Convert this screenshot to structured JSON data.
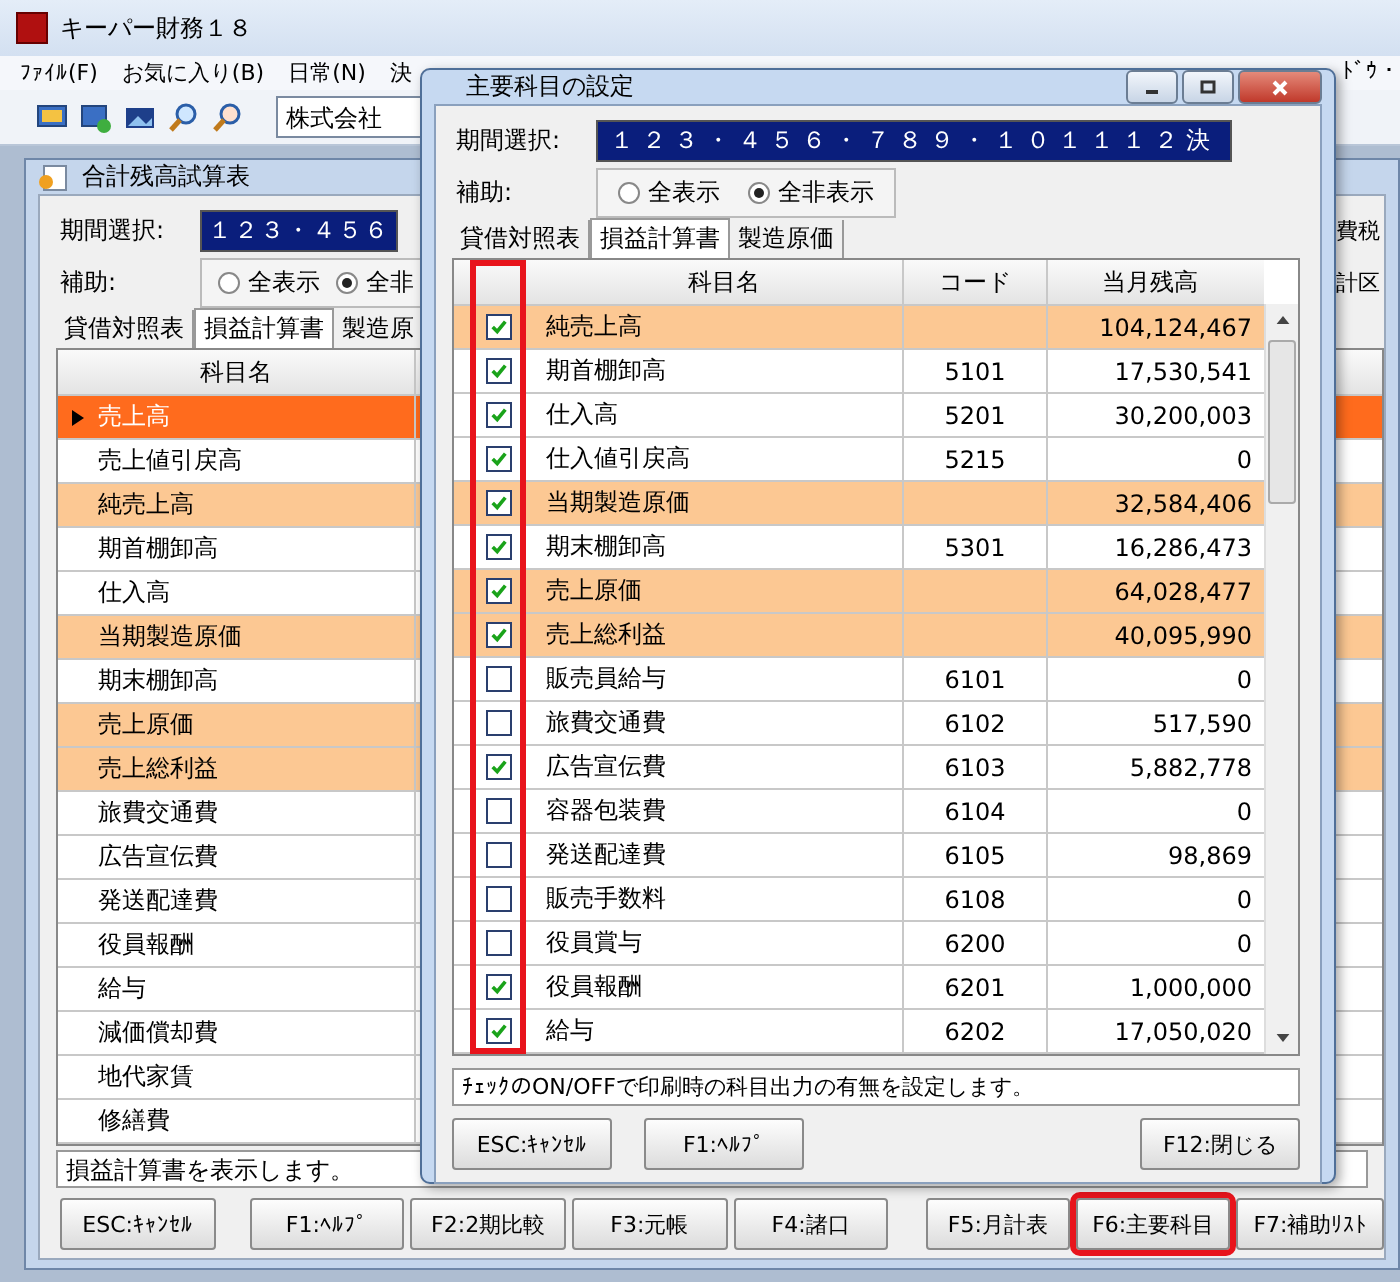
{
  "app": {
    "title": "キーパー財務１８",
    "menu": [
      "ﾌｧｲﾙ(F)",
      "お気に入り(B)",
      "日常(N)",
      "決"
    ],
    "menu_right": "ﾄﾞｳ・",
    "toolbar_combo": "株式会社"
  },
  "report_window": {
    "title": "合計残高試算表",
    "period_label": "期間選択:",
    "period_value": "１２３・４５６",
    "aux_label": "補助:",
    "aux_options": [
      {
        "label": "全表示",
        "selected": false
      },
      {
        "label": "全非",
        "selected": true
      }
    ],
    "tabs": [
      {
        "label": "貸借対照表",
        "selected": false
      },
      {
        "label": "損益計算書",
        "selected": true
      },
      {
        "label": "製造原",
        "selected": false
      }
    ],
    "side_labels": [
      "費税",
      "計区"
    ],
    "grid": {
      "column": "科目名",
      "rows": [
        {
          "name": "売上高",
          "highlighted": true,
          "selected": true
        },
        {
          "name": "売上値引戻高",
          "highlighted": false,
          "selected": false
        },
        {
          "name": "純売上高",
          "highlighted": true,
          "selected": false
        },
        {
          "name": "期首棚卸高",
          "highlighted": false,
          "selected": false
        },
        {
          "name": "仕入高",
          "highlighted": false,
          "selected": false
        },
        {
          "name": "当期製造原価",
          "highlighted": true,
          "selected": false
        },
        {
          "name": "期末棚卸高",
          "highlighted": false,
          "selected": false
        },
        {
          "name": "売上原価",
          "highlighted": true,
          "selected": false
        },
        {
          "name": "売上総利益",
          "highlighted": true,
          "selected": false
        },
        {
          "name": "旅費交通費",
          "highlighted": false,
          "selected": false
        },
        {
          "name": "広告宣伝費",
          "highlighted": false,
          "selected": false
        },
        {
          "name": "発送配達費",
          "highlighted": false,
          "selected": false
        },
        {
          "name": "役員報酬",
          "highlighted": false,
          "selected": false
        },
        {
          "name": "給与",
          "highlighted": false,
          "selected": false
        },
        {
          "name": "減価償却費",
          "highlighted": false,
          "selected": false
        },
        {
          "name": "地代家賃",
          "highlighted": false,
          "selected": false
        },
        {
          "name": "修繕費",
          "highlighted": false,
          "selected": false
        }
      ]
    },
    "status": "損益計算書を表示します。",
    "buttons": [
      {
        "label": "ESC:ｷｬﾝｾﾙ",
        "marked": false
      },
      {
        "label": "F1:ﾍﾙﾌﾟ",
        "marked": false
      },
      {
        "label": "F2:2期比較",
        "marked": false
      },
      {
        "label": "F3:元帳",
        "marked": false
      },
      {
        "label": "F4:諸口",
        "marked": false
      },
      {
        "label": "F5:月計表",
        "marked": false
      },
      {
        "label": "F6:主要科目",
        "marked": true
      },
      {
        "label": "F7:補助ﾘｽﾄ",
        "marked": false
      }
    ]
  },
  "dialog": {
    "title": "主要科目の設定",
    "period_label": "期間選択:",
    "period_value": "１２３・４５６・７８９・１０１１１２決",
    "aux_label": "補助:",
    "aux_options": [
      {
        "label": "全表示",
        "selected": false
      },
      {
        "label": "全非表示",
        "selected": true
      }
    ],
    "tabs": [
      {
        "label": "貸借対照表",
        "selected": false
      },
      {
        "label": "損益計算書",
        "selected": true
      },
      {
        "label": "製造原価",
        "selected": false
      }
    ],
    "columns": [
      "科目名",
      "コード",
      "当月残高"
    ],
    "check_column_marked": true,
    "rows": [
      {
        "checked": true,
        "name": "純売上高",
        "code": "",
        "balance": "104,124,467",
        "highlighted": true
      },
      {
        "checked": true,
        "name": "期首棚卸高",
        "code": "5101",
        "balance": "17,530,541",
        "highlighted": false
      },
      {
        "checked": true,
        "name": "仕入高",
        "code": "5201",
        "balance": "30,200,003",
        "highlighted": false
      },
      {
        "checked": true,
        "name": "仕入値引戻高",
        "code": "5215",
        "balance": "0",
        "highlighted": false
      },
      {
        "checked": true,
        "name": "当期製造原価",
        "code": "",
        "balance": "32,584,406",
        "highlighted": true
      },
      {
        "checked": true,
        "name": "期末棚卸高",
        "code": "5301",
        "balance": "16,286,473",
        "highlighted": false
      },
      {
        "checked": true,
        "name": "売上原価",
        "code": "",
        "balance": "64,028,477",
        "highlighted": true
      },
      {
        "checked": true,
        "name": "売上総利益",
        "code": "",
        "balance": "40,095,990",
        "highlighted": true
      },
      {
        "checked": false,
        "name": "販売員給与",
        "code": "6101",
        "balance": "0",
        "highlighted": false
      },
      {
        "checked": false,
        "name": "旅費交通費",
        "code": "6102",
        "balance": "517,590",
        "highlighted": false
      },
      {
        "checked": true,
        "name": "広告宣伝費",
        "code": "6103",
        "balance": "5,882,778",
        "highlighted": false
      },
      {
        "checked": false,
        "name": "容器包装費",
        "code": "6104",
        "balance": "0",
        "highlighted": false
      },
      {
        "checked": false,
        "name": "発送配達費",
        "code": "6105",
        "balance": "98,869",
        "highlighted": false
      },
      {
        "checked": false,
        "name": "販売手数料",
        "code": "6108",
        "balance": "0",
        "highlighted": false
      },
      {
        "checked": false,
        "name": "役員賞与",
        "code": "6200",
        "balance": "0",
        "highlighted": false
      },
      {
        "checked": true,
        "name": "役員報酬",
        "code": "6201",
        "balance": "1,000,000",
        "highlighted": false
      },
      {
        "checked": true,
        "name": "給与",
        "code": "6202",
        "balance": "17,050,020",
        "highlighted": false
      }
    ],
    "hint": "ﾁｪｯｸのON/OFFで印刷時の科目出力の有無を設定します。",
    "buttons": [
      "ESC:ｷｬﾝｾﾙ",
      "F1:ﾍﾙﾌﾟ",
      "F12:閉じる"
    ]
  }
}
